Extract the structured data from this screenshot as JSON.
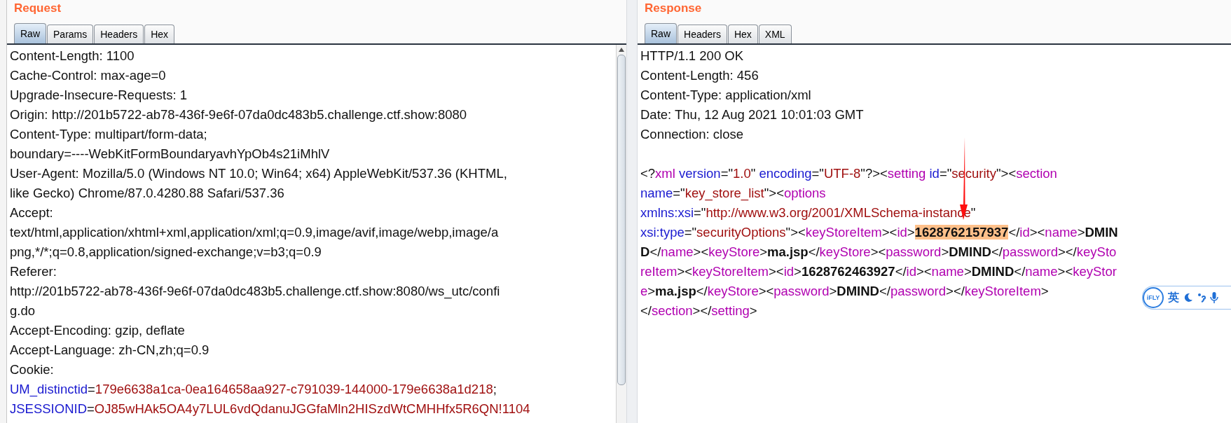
{
  "request": {
    "title": "Request",
    "tabs": [
      {
        "label": "Raw",
        "selected": true
      },
      {
        "label": "Params",
        "selected": false
      },
      {
        "label": "Headers",
        "selected": false
      },
      {
        "label": "Hex",
        "selected": false
      }
    ],
    "lines": [
      [
        {
          "kind": "text",
          "text": "Content-Length: 1100"
        }
      ],
      [
        {
          "kind": "text",
          "text": "Cache-Control: max-age=0"
        }
      ],
      [
        {
          "kind": "text",
          "text": "Upgrade-Insecure-Requests: 1"
        }
      ],
      [
        {
          "kind": "text",
          "text": "Origin: http://201b5722-ab78-436f-9e6f-07da0dc483b5.challenge.ctf.show:8080"
        }
      ],
      [
        {
          "kind": "text",
          "text": "Content-Type: multipart/form-data;"
        }
      ],
      [
        {
          "kind": "text",
          "text": "boundary=----WebKitFormBoundaryavhYpOb4s21iMhlV"
        }
      ],
      [
        {
          "kind": "text",
          "text": "User-Agent: Mozilla/5.0 (Windows NT 10.0; Win64; x64) AppleWebKit/537.36 (KHTML,"
        }
      ],
      [
        {
          "kind": "text",
          "text": "like Gecko) Chrome/87.0.4280.88 Safari/537.36"
        }
      ],
      [
        {
          "kind": "text",
          "text": "Accept:"
        }
      ],
      [
        {
          "kind": "text",
          "text": "text/html,application/xhtml+xml,application/xml;q=0.9,image/avif,image/webp,image/a"
        }
      ],
      [
        {
          "kind": "text",
          "text": "png,*/*;q=0.8,application/signed-exchange;v=b3;q=0.9"
        }
      ],
      [
        {
          "kind": "text",
          "text": "Referer:"
        }
      ],
      [
        {
          "kind": "text",
          "text": "http://201b5722-ab78-436f-9e6f-07da0dc483b5.challenge.ctf.show:8080/ws_utc/confi"
        }
      ],
      [
        {
          "kind": "text",
          "text": "g.do"
        }
      ],
      [
        {
          "kind": "text",
          "text": "Accept-Encoding: gzip, deflate"
        }
      ],
      [
        {
          "kind": "text",
          "text": "Accept-Language: zh-CN,zh;q=0.9"
        }
      ],
      [
        {
          "kind": "text",
          "text": "Cookie:"
        }
      ],
      [
        {
          "kind": "attr",
          "text": "UM_distinctid"
        },
        {
          "kind": "text",
          "text": "="
        },
        {
          "kind": "value",
          "text": "179e6638a1ca-0ea164658aa927-c791039-144000-179e6638a1d218"
        },
        {
          "kind": "text",
          "text": ";"
        }
      ],
      [
        {
          "kind": "attr",
          "text": "JSESSIONID"
        },
        {
          "kind": "text",
          "text": "="
        },
        {
          "kind": "value",
          "text": "OJ85wHAk5OA4y7LUL6vdQdanuJGGfaMln2HISzdWtCMHHfx5R6QN!1104"
        }
      ]
    ]
  },
  "response": {
    "title": "Response",
    "tabs": [
      {
        "label": "Raw",
        "selected": true
      },
      {
        "label": "Headers",
        "selected": false
      },
      {
        "label": "Hex",
        "selected": false
      },
      {
        "label": "XML",
        "selected": false
      }
    ],
    "lines": [
      [
        {
          "kind": "text",
          "text": "HTTP/1.1 200 OK"
        }
      ],
      [
        {
          "kind": "text",
          "text": "Content-Length: 456"
        }
      ],
      [
        {
          "kind": "text",
          "text": "Content-Type: application/xml"
        }
      ],
      [
        {
          "kind": "text",
          "text": "Date: Thu, 12 Aug 2021 10:01:03 GMT"
        }
      ],
      [
        {
          "kind": "text",
          "text": "Connection: close"
        }
      ]
    ],
    "body_lines": [
      [
        {
          "kind": "text",
          "text": "<?"
        },
        {
          "kind": "tag",
          "text": "xml"
        },
        {
          "kind": "attr",
          "text": " version"
        },
        {
          "kind": "text",
          "text": "=\""
        },
        {
          "kind": "value",
          "text": "1.0"
        },
        {
          "kind": "text",
          "text": "\" "
        },
        {
          "kind": "attr",
          "text": "encoding"
        },
        {
          "kind": "text",
          "text": "=\""
        },
        {
          "kind": "value",
          "text": "UTF-8"
        },
        {
          "kind": "text",
          "text": "\"?><"
        },
        {
          "kind": "tag",
          "text": "setting"
        },
        {
          "kind": "attr",
          "text": " id"
        },
        {
          "kind": "text",
          "text": "=\""
        },
        {
          "kind": "value",
          "text": "security"
        },
        {
          "kind": "text",
          "text": "\"><"
        },
        {
          "kind": "tag",
          "text": "section"
        }
      ],
      [
        {
          "kind": "attr",
          "text": "name"
        },
        {
          "kind": "text",
          "text": "=\""
        },
        {
          "kind": "value",
          "text": "key_store_list"
        },
        {
          "kind": "text",
          "text": "\"><"
        },
        {
          "kind": "tag",
          "text": "options"
        }
      ],
      [
        {
          "kind": "attr",
          "text": "xmlns:xsi"
        },
        {
          "kind": "text",
          "text": "=\""
        },
        {
          "kind": "value",
          "text": "http://www.w3.org/2001/XMLSchema-instance"
        },
        {
          "kind": "text",
          "text": "\""
        }
      ],
      [
        {
          "kind": "attr",
          "text": "xsi:type"
        },
        {
          "kind": "text",
          "text": "=\""
        },
        {
          "kind": "value",
          "text": "securityOptions"
        },
        {
          "kind": "text",
          "text": "\"><"
        },
        {
          "kind": "tag",
          "text": "keyStoreItem"
        },
        {
          "kind": "text",
          "text": "><"
        },
        {
          "kind": "tag",
          "text": "id"
        },
        {
          "kind": "text",
          "text": ">"
        },
        {
          "kind": "highlight",
          "text": "1628762157937"
        },
        {
          "kind": "text",
          "text": "</"
        },
        {
          "kind": "tag",
          "text": "id"
        },
        {
          "kind": "text",
          "text": "><"
        },
        {
          "kind": "tag",
          "text": "name"
        },
        {
          "kind": "text",
          "text": ">"
        },
        {
          "kind": "bold",
          "text": "DMIN"
        }
      ],
      [
        {
          "kind": "bold",
          "text": "D"
        },
        {
          "kind": "text",
          "text": "</"
        },
        {
          "kind": "tag",
          "text": "name"
        },
        {
          "kind": "text",
          "text": "><"
        },
        {
          "kind": "tag",
          "text": "keyStore"
        },
        {
          "kind": "text",
          "text": ">"
        },
        {
          "kind": "bold",
          "text": "ma.jsp"
        },
        {
          "kind": "text",
          "text": "</"
        },
        {
          "kind": "tag",
          "text": "keyStore"
        },
        {
          "kind": "text",
          "text": "><"
        },
        {
          "kind": "tag",
          "text": "password"
        },
        {
          "kind": "text",
          "text": ">"
        },
        {
          "kind": "bold",
          "text": "DMIND"
        },
        {
          "kind": "text",
          "text": "</"
        },
        {
          "kind": "tag",
          "text": "password"
        },
        {
          "kind": "text",
          "text": "></"
        },
        {
          "kind": "tag",
          "text": "keySto"
        }
      ],
      [
        {
          "kind": "tag",
          "text": "reItem"
        },
        {
          "kind": "text",
          "text": "><"
        },
        {
          "kind": "tag",
          "text": "keyStoreItem"
        },
        {
          "kind": "text",
          "text": "><"
        },
        {
          "kind": "tag",
          "text": "id"
        },
        {
          "kind": "text",
          "text": ">"
        },
        {
          "kind": "bold",
          "text": "1628762463927"
        },
        {
          "kind": "text",
          "text": "</"
        },
        {
          "kind": "tag",
          "text": "id"
        },
        {
          "kind": "text",
          "text": "><"
        },
        {
          "kind": "tag",
          "text": "name"
        },
        {
          "kind": "text",
          "text": ">"
        },
        {
          "kind": "bold",
          "text": "DMIND"
        },
        {
          "kind": "text",
          "text": "</"
        },
        {
          "kind": "tag",
          "text": "name"
        },
        {
          "kind": "text",
          "text": "><"
        },
        {
          "kind": "tag",
          "text": "keyStor"
        }
      ],
      [
        {
          "kind": "tag",
          "text": "e"
        },
        {
          "kind": "text",
          "text": ">"
        },
        {
          "kind": "bold",
          "text": "ma.jsp"
        },
        {
          "kind": "text",
          "text": "</"
        },
        {
          "kind": "tag",
          "text": "keyStore"
        },
        {
          "kind": "text",
          "text": "><"
        },
        {
          "kind": "tag",
          "text": "password"
        },
        {
          "kind": "text",
          "text": ">"
        },
        {
          "kind": "bold",
          "text": "DMIND"
        },
        {
          "kind": "text",
          "text": "</"
        },
        {
          "kind": "tag",
          "text": "password"
        },
        {
          "kind": "text",
          "text": "></"
        },
        {
          "kind": "tag",
          "text": "keyStoreItem"
        },
        {
          "kind": "text",
          "text": ">"
        }
      ],
      [
        {
          "kind": "text",
          "text": "</"
        },
        {
          "kind": "tag",
          "text": "section"
        },
        {
          "kind": "text",
          "text": "></"
        },
        {
          "kind": "tag",
          "text": "setting"
        },
        {
          "kind": "text",
          "text": ">"
        }
      ]
    ]
  },
  "ime_toolbar": {
    "logo": "iFLY",
    "language": "英"
  }
}
